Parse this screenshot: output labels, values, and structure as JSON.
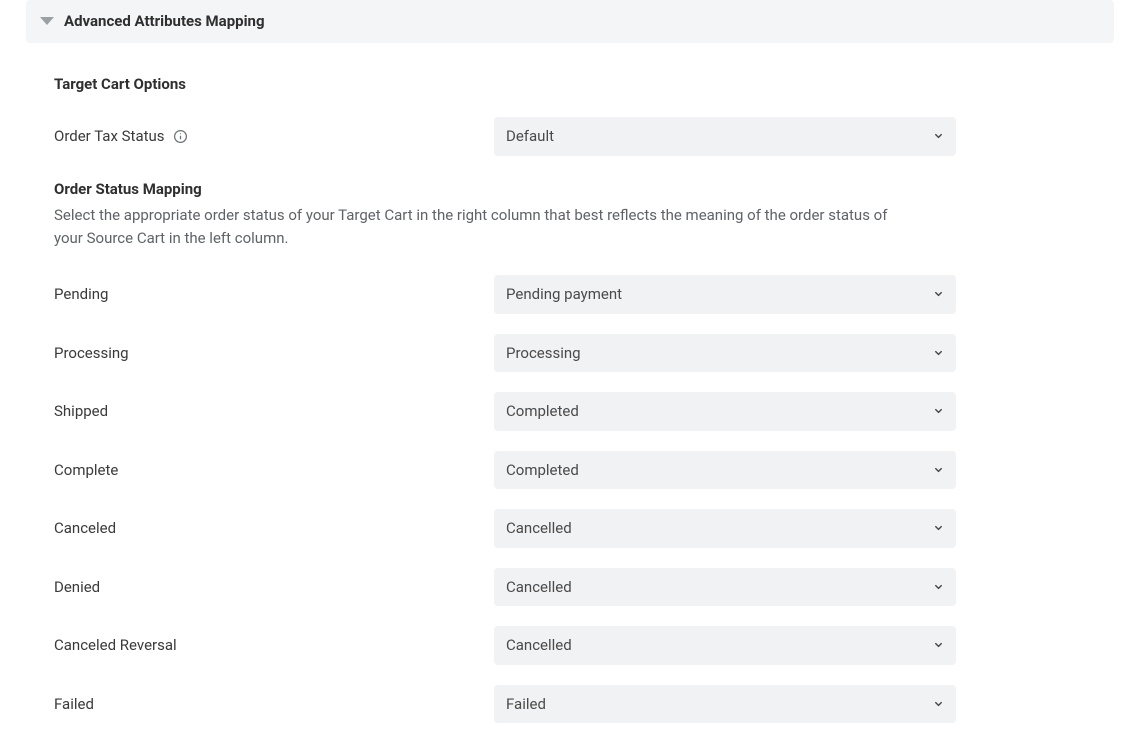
{
  "panel": {
    "title": "Advanced Attributes Mapping"
  },
  "targetCartOptions": {
    "heading": "Target Cart Options",
    "orderTaxStatus": {
      "label": "Order Tax Status",
      "value": "Default"
    }
  },
  "orderStatusMapping": {
    "heading": "Order Status Mapping",
    "description": "Select the appropriate order status of your Target Cart in the right column that best reflects the meaning of the order status of your Source Cart in the left column.",
    "rows": [
      {
        "source": "Pending",
        "target": "Pending payment"
      },
      {
        "source": "Processing",
        "target": "Processing"
      },
      {
        "source": "Shipped",
        "target": "Completed"
      },
      {
        "source": "Complete",
        "target": "Completed"
      },
      {
        "source": "Canceled",
        "target": "Cancelled"
      },
      {
        "source": "Denied",
        "target": "Cancelled"
      },
      {
        "source": "Canceled Reversal",
        "target": "Cancelled"
      },
      {
        "source": "Failed",
        "target": "Failed"
      }
    ]
  }
}
